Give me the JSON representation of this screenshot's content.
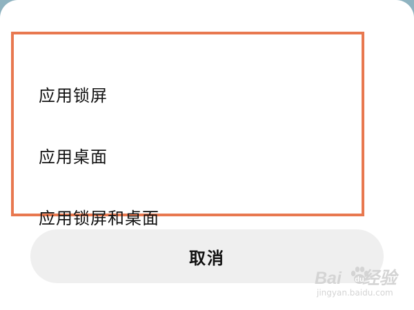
{
  "menu": {
    "items": [
      {
        "label": "应用锁屏"
      },
      {
        "label": "应用桌面"
      },
      {
        "label": "应用锁屏和桌面"
      }
    ]
  },
  "cancel_label": "取消",
  "watermark": {
    "logo_left": "Bai",
    "logo_right": "经验",
    "subtitle": "jingyan.baidu.com"
  },
  "colors": {
    "highlight_border": "#e8784f",
    "sheet_background": "#ffffff",
    "cancel_background": "#efefef"
  }
}
